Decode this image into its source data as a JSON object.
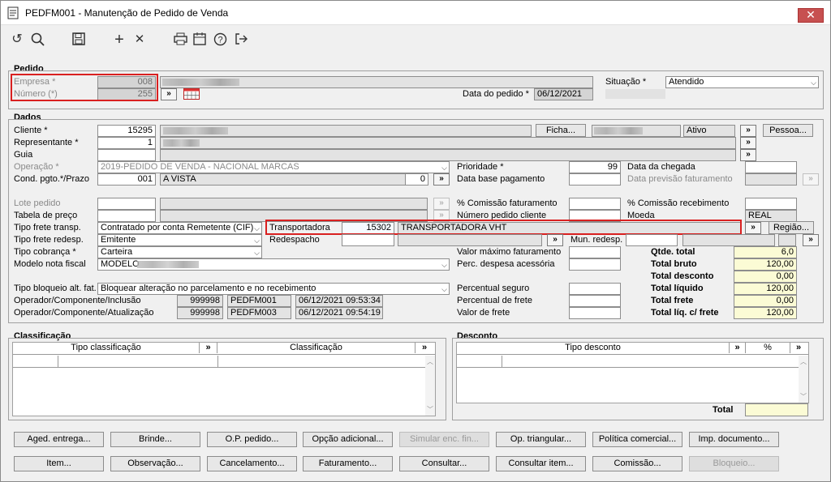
{
  "window": {
    "title": "PEDFM001 - Manutenção de Pedido de Venda",
    "close": "✕"
  },
  "toolbar": {
    "refresh": "↺",
    "search": "⌕",
    "save": "💾",
    "add": "+",
    "remove": "✕",
    "print": "🖶",
    "calendar": "📅",
    "help": "?",
    "exit": "⇥"
  },
  "pedido": {
    "section": "Pedido",
    "empresa_label": "Empresa *",
    "empresa_value": "008",
    "numero_label": "Número (*)",
    "numero_value": "255",
    "nav": "»",
    "data_label": "Data do pedido *",
    "data_value": "06/12/2021",
    "situacao_label": "Situação *",
    "situacao_value": "Atendido"
  },
  "dados": {
    "section": "Dados",
    "cliente_label": "Cliente *",
    "cliente_value": "15295",
    "ficha_button": "Ficha...",
    "ativo_value": "Ativo",
    "pessoa_button": "Pessoa...",
    "representante_label": "Representante *",
    "representante_value": "1",
    "guia_label": "Guia",
    "operacao_label": "Operação *",
    "operacao_value": "2019-PEDIDO DE VENDA - NACIONAL MARCAS",
    "condpgto_label": "Cond. pgto.*/Prazo",
    "condpgto_value": "001",
    "condpgto_desc": "A VISTA",
    "prazo_value": "0",
    "prioridade_label": "Prioridade *",
    "prioridade_value": "99",
    "data_chegada_label": "Data da chegada",
    "data_base_label": "Data base pagamento",
    "data_prev_label": "Data previsão faturamento",
    "lote_label": "Lote pedido",
    "tabela_label": "Tabela de preço",
    "comissao_fat_label": "% Comissão faturamento",
    "comissao_rec_label": "% Comissão recebimento",
    "num_pedido_cli_label": "Número pedido cliente",
    "moeda_label": "Moeda",
    "moeda_value": "REAL",
    "frete_label": "Tipo frete transp.",
    "frete_value": "Contratado por conta Remetente (CIF)",
    "transportadora_label": "Transportadora",
    "transportadora_value": "15302",
    "transportadora_desc": "TRANSPORTADORA VHT",
    "regiao_button": "Região...",
    "frete_redesp_label": "Tipo frete redesp.",
    "frete_redesp_value": "Emitente",
    "redespacho_label": "Redespacho",
    "mun_redesp_label": "Mun. redesp.",
    "cobranca_label": "Tipo cobrança *",
    "cobranca_value": "Carteira",
    "valor_max_label": "Valor máximo faturamento",
    "modelo_label": "Modelo nota fiscal",
    "modelo_value": "MODELO",
    "perc_desp_label": "Perc. despesa acessória",
    "bloqueio_label": "Tipo bloqueio alt. fat.",
    "bloqueio_value": "Bloquear alteração no parcelamento e no recebimento",
    "perc_seguro_label": "Percentual seguro",
    "perc_frete_label": "Percentual de frete",
    "valor_frete_label": "Valor de frete",
    "op_inclusao_label": "Operador/Componente/Inclusão",
    "op_inclusao_user": "999998",
    "op_inclusao_comp": "PEDFM001",
    "op_inclusao_dt": "06/12/2021 09:53:34",
    "op_atual_label": "Operador/Componente/Atualização",
    "op_atual_user": "999998",
    "op_atual_comp": "PEDFM003",
    "op_atual_dt": "06/12/2021 09:54:19"
  },
  "totais": {
    "qtde_label": "Qtde. total",
    "qtde_value": "6,0",
    "bruto_label": "Total bruto",
    "bruto_value": "120,00",
    "desconto_label": "Total desconto",
    "desconto_value": "0,00",
    "liquido_label": "Total líquido",
    "liquido_value": "120,00",
    "frete_label": "Total frete",
    "frete_value": "0,00",
    "liq_frete_label": "Total líq. c/ frete",
    "liq_frete_value": "120,00"
  },
  "classificacao": {
    "section": "Classificação",
    "col_tipo": "Tipo classificação",
    "col_class": "Classificação",
    "nav": "»"
  },
  "desconto": {
    "section": "Desconto",
    "col_tipo": "Tipo desconto",
    "col_pct": "%",
    "nav": "»",
    "total_label": "Total"
  },
  "buttons_row1": [
    "Aged. entrega...",
    "Brinde...",
    "O.P. pedido...",
    "Opção adicional...",
    "Simular enc. fin...",
    "Op. triangular...",
    "Política comercial...",
    "Imp. documento..."
  ],
  "buttons_row2": [
    "Item...",
    "Observação...",
    "Cancelamento...",
    "Faturamento...",
    "Consultar...",
    "Consultar item...",
    "Comissão...",
    "Bloqueio..."
  ]
}
